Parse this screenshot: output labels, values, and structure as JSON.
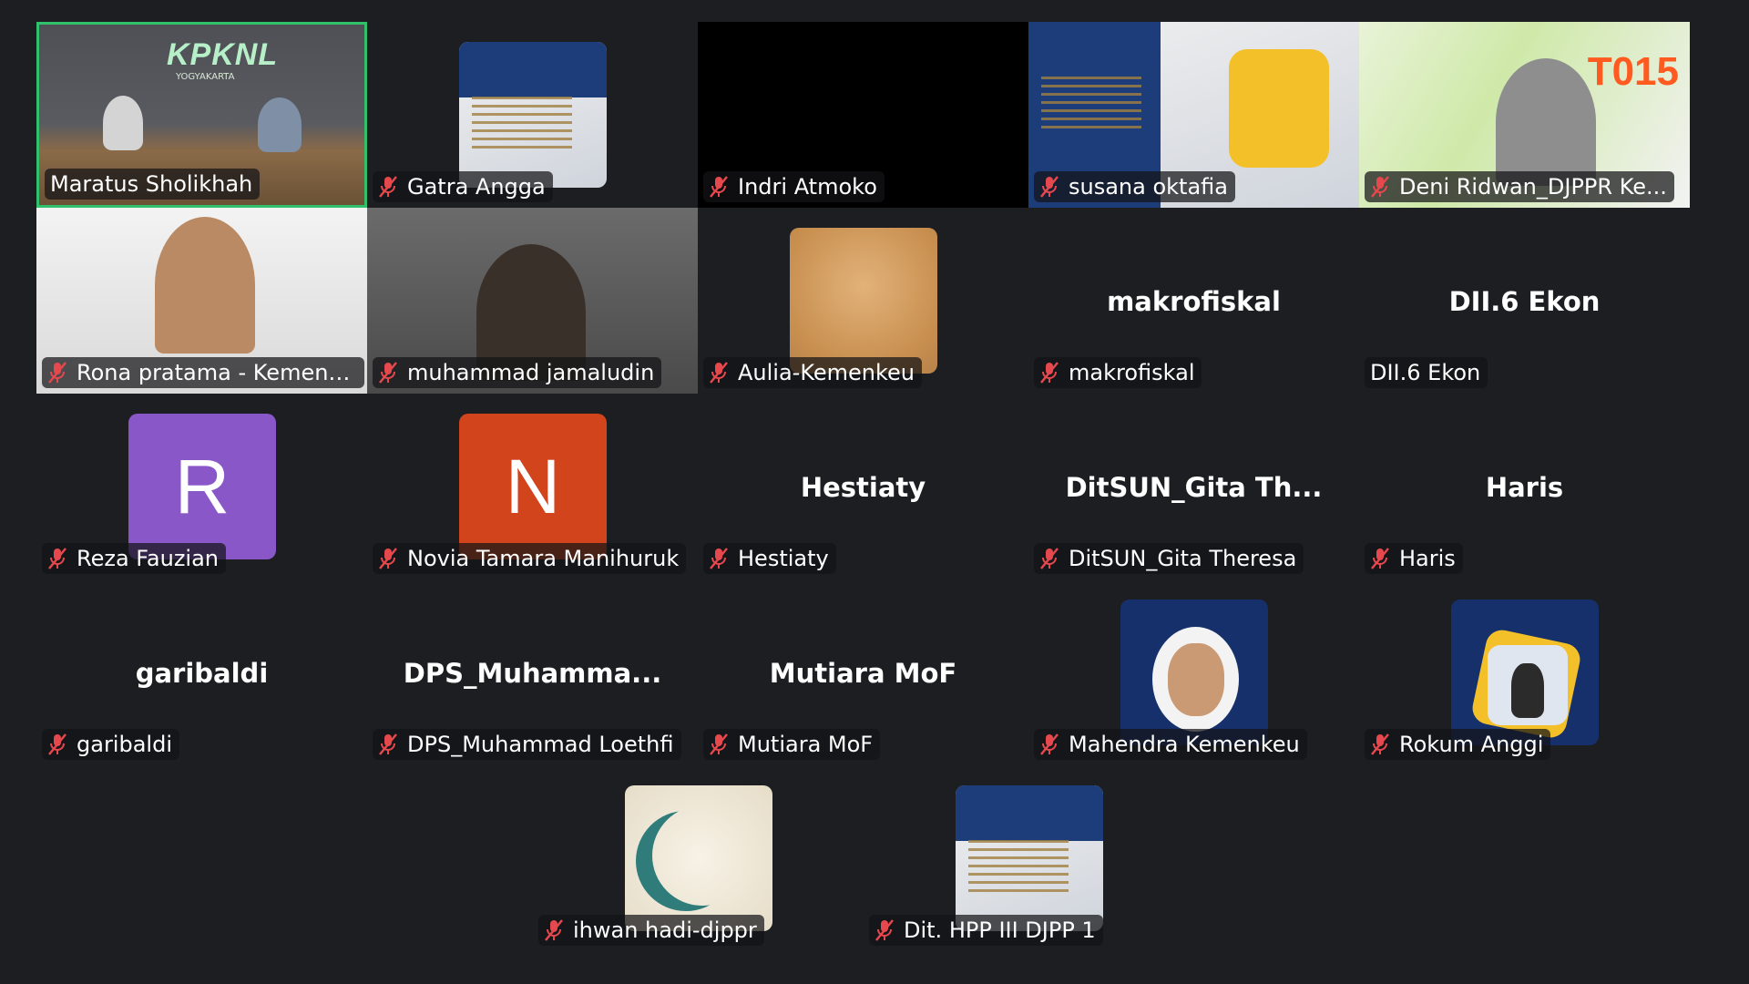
{
  "participants": [
    {
      "name": "Maratus Sholikhah",
      "title": "",
      "muted": false,
      "active": true,
      "sign": "KPKNL",
      "sign_sub": "YOGYAKARTA"
    },
    {
      "name": "Gatra Angga",
      "title": "",
      "muted": true
    },
    {
      "name": "Indri Atmoko",
      "title": "",
      "muted": true
    },
    {
      "name": "susana oktafia",
      "title": "",
      "muted": true
    },
    {
      "name": "Deni Ridwan_DJPPR Ke...",
      "title": "",
      "muted": true,
      "banner_text": "T015"
    },
    {
      "name": "Rona pratama - Kemenk...",
      "title": "",
      "muted": true
    },
    {
      "name": "muhammad jamaludin",
      "title": "",
      "muted": true
    },
    {
      "name": "Aulia-Kemenkeu",
      "title": "",
      "muted": true
    },
    {
      "name": "makrofiskal",
      "title": "makrofiskal",
      "muted": true
    },
    {
      "name": "DII.6 Ekon",
      "title": "DII.6 Ekon",
      "muted": false
    },
    {
      "name": "Reza Fauzian",
      "title": "",
      "muted": true,
      "letter": "R",
      "letter_color": "#8a57c9"
    },
    {
      "name": "Novia Tamara Manihuruk",
      "title": "",
      "muted": true,
      "letter": "N",
      "letter_color": "#d1441c"
    },
    {
      "name": "Hestiaty",
      "title": "Hestiaty",
      "muted": true
    },
    {
      "name": "DitSUN_Gita Theresa",
      "title": "DitSUN_Gita  Th...",
      "muted": true
    },
    {
      "name": "Haris",
      "title": "Haris",
      "muted": true
    },
    {
      "name": "garibaldi",
      "title": "garibaldi",
      "muted": true
    },
    {
      "name": "DPS_Muhammad Loethfi",
      "title": "DPS_Muhamma...",
      "muted": true
    },
    {
      "name": "Mutiara MoF",
      "title": "Mutiara MoF",
      "muted": true
    },
    {
      "name": "Mahendra Kemenkeu",
      "title": "",
      "muted": true
    },
    {
      "name": "Rokum Anggi",
      "title": "",
      "muted": true
    },
    {
      "name": "ihwan hadi-djppr",
      "title": "",
      "muted": true
    },
    {
      "name": "Dit. HPP III DJPP 1",
      "title": "",
      "muted": true
    }
  ],
  "colors": {
    "background": "#1c1e22",
    "active_border": "#31c06b",
    "mute_red": "#e5484d"
  },
  "icons": {
    "mute": "microphone-muted-icon"
  }
}
